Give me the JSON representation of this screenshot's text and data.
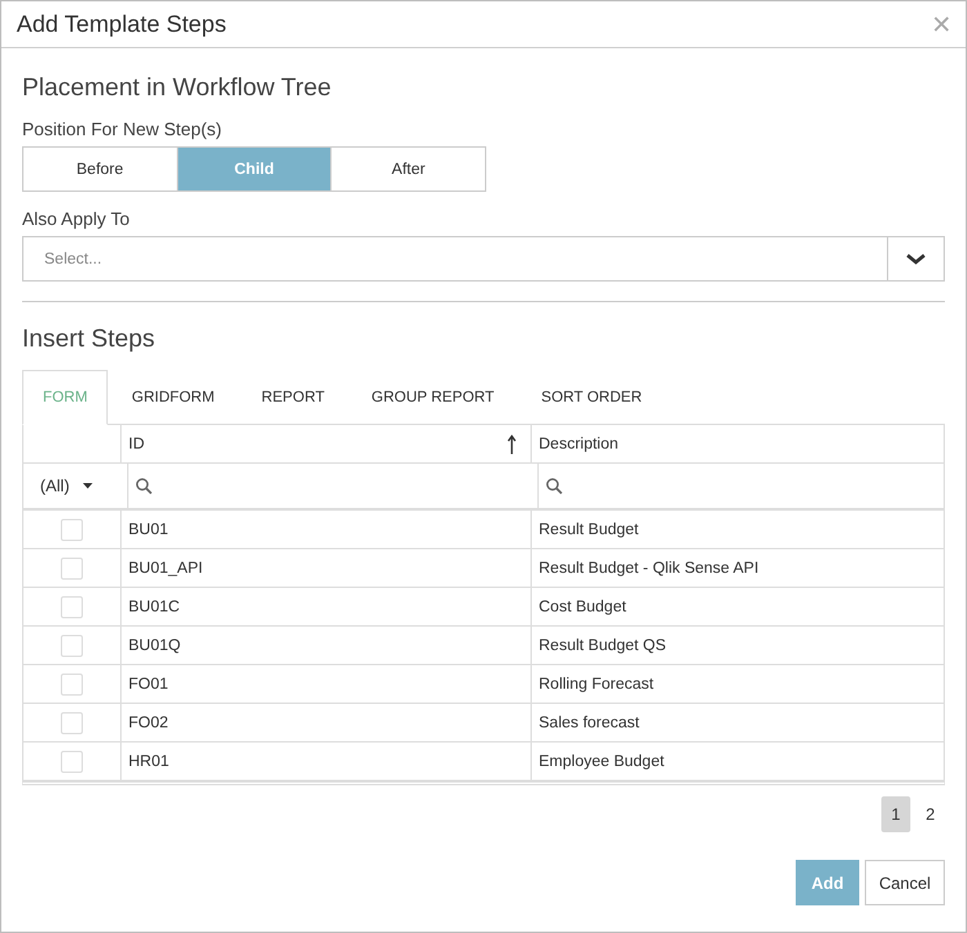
{
  "window": {
    "title": "Add Template Steps",
    "close": "✕"
  },
  "placement": {
    "heading": "Placement in Workflow Tree",
    "label": "Position For New Step(s)",
    "options": [
      {
        "label": "Before",
        "selected": false
      },
      {
        "label": "Child",
        "selected": true
      },
      {
        "label": "After",
        "selected": false
      }
    ]
  },
  "apply": {
    "label": "Also Apply To",
    "placeholder": "Select..."
  },
  "insert": {
    "heading": "Insert Steps",
    "tabs": [
      {
        "label": "FORM",
        "selected": true
      },
      {
        "label": "GRIDFORM",
        "selected": false
      },
      {
        "label": "REPORT",
        "selected": false
      },
      {
        "label": "GROUP REPORT",
        "selected": false
      },
      {
        "label": "SORT ORDER",
        "selected": false
      }
    ],
    "table": {
      "columns": [
        {
          "label": "ID",
          "sorted": true
        },
        {
          "label": "Description",
          "sorted": false
        }
      ],
      "filter": "(All)",
      "rows": [
        {
          "checked": false,
          "id": "BU01",
          "description": "Result Budget"
        },
        {
          "checked": false,
          "id": "BU01_API",
          "description": "Result Budget - Qlik Sense API"
        },
        {
          "checked": false,
          "id": "BU01C",
          "description": "Cost Budget"
        },
        {
          "checked": false,
          "id": "BU01Q",
          "description": "Result Budget QS"
        },
        {
          "checked": false,
          "id": "FO01",
          "description": "Rolling Forecast"
        },
        {
          "checked": false,
          "id": "FO02",
          "description": "Sales forecast"
        },
        {
          "checked": false,
          "id": "HR01",
          "description": "Employee Budget"
        }
      ]
    },
    "pages": [
      {
        "label": "1",
        "selected": true
      },
      {
        "label": "2",
        "selected": false
      }
    ]
  },
  "buttons": [
    {
      "label": "Add",
      "kind": "primary"
    },
    {
      "label": "Cancel",
      "kind": "secondary"
    }
  ]
}
